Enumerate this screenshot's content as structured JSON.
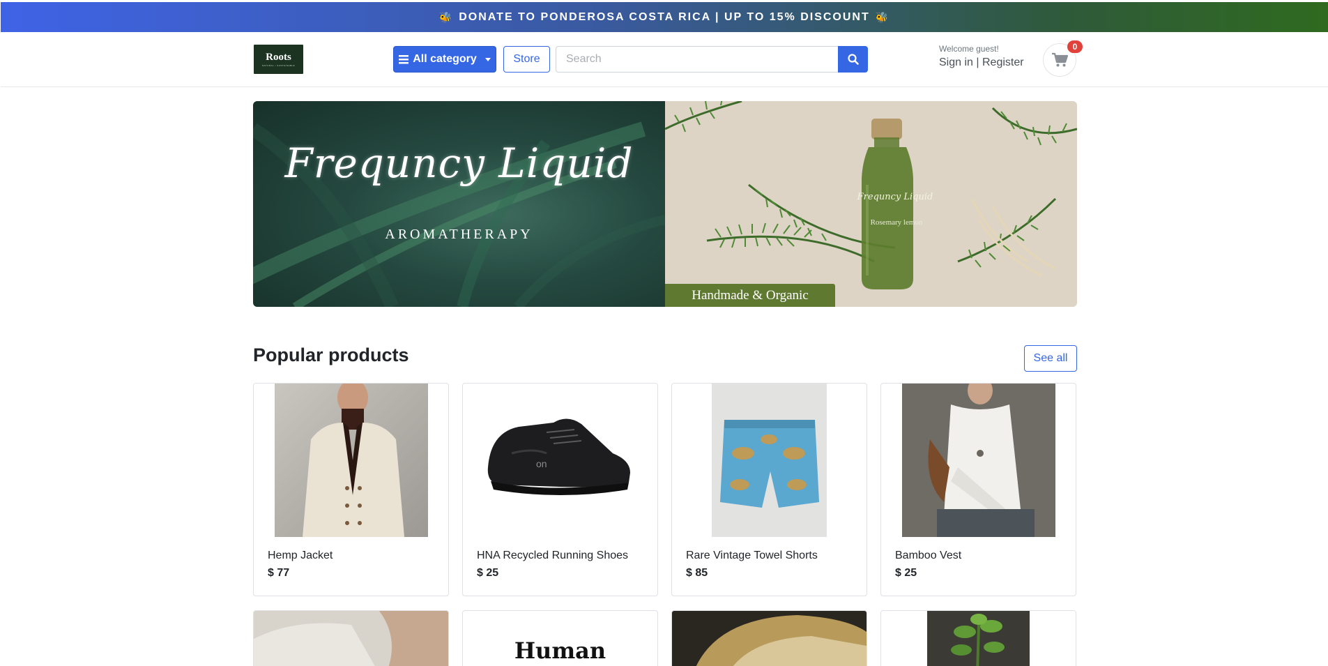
{
  "promo": {
    "text": "DONATE TO PONDEROSA COSTA RICA | UP TO 15% DISCOUNT"
  },
  "header": {
    "logo_text": "Roots",
    "logo_sub": "NATURAL • SUSTAINABLE",
    "category_label": "All category",
    "store_label": "Store",
    "search_placeholder": "Search",
    "welcome": "Welcome guest!",
    "sign_in": "Sign in",
    "separator": "|",
    "register": "Register",
    "cart_count": "0"
  },
  "banner": {
    "title": "Frequncy Liquid",
    "subtitle": "AROMATHERAPY",
    "bottle_brand": "Frequncy Liquid",
    "bottle_label": "Rosemary lemon",
    "badge": "Handmade & Organic"
  },
  "popular": {
    "title": "Popular products",
    "see_all": "See all",
    "products": [
      {
        "name": "Hemp Jacket",
        "price": "$ 77"
      },
      {
        "name": "HNA Recycled Running Shoes",
        "price": "$ 25"
      },
      {
        "name": "Rare Vintage Towel Shorts",
        "price": "$ 85"
      },
      {
        "name": "Bamboo Vest",
        "price": "$ 25"
      }
    ],
    "row2": [
      {
        "caption": ""
      },
      {
        "caption": "Human"
      },
      {
        "caption": ""
      },
      {
        "caption": ""
      }
    ]
  },
  "colors": {
    "primary": "#3566e4",
    "badge": "#e0413a",
    "banner_badge": "#5f7a30"
  }
}
